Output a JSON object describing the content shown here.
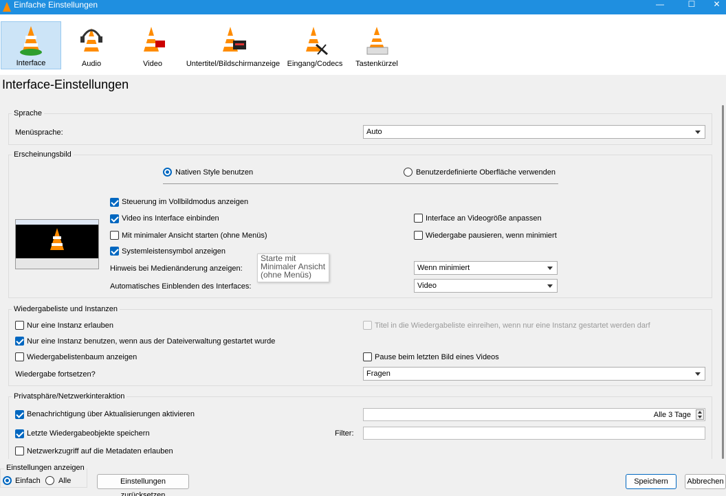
{
  "window": {
    "title": "Einfache Einstellungen",
    "minimize": "—",
    "maximize": "☐",
    "close": "✕"
  },
  "toolbar": {
    "items": [
      {
        "label": "Interface"
      },
      {
        "label": "Audio"
      },
      {
        "label": "Video"
      },
      {
        "label": "Untertitel/Bildschirmanzeige"
      },
      {
        "label": "Eingang/Codecs"
      },
      {
        "label": "Tastenkürzel"
      }
    ]
  },
  "page_title": "Interface-Einstellungen",
  "sprache": {
    "group_title": "Sprache",
    "menu_label": "Menüsprache:",
    "menu_value": "Auto"
  },
  "erscheinung": {
    "group_title": "Erscheinungsbild",
    "radio_native": "Nativen Style benutzen",
    "radio_custom": "Benutzerdefinierte Oberfläche verwenden",
    "chk_fullscreen": "Steuerung im Vollbildmodus anzeigen",
    "chk_embed": "Video ins Interface einbinden",
    "chk_minimal": "Mit minimaler Ansicht starten (ohne Menüs)",
    "chk_systray": "Systemleistensymbol anzeigen",
    "chk_resize": "Interface an Videogröße anpassen",
    "chk_pause_min": "Wiedergabe pausieren, wenn minimiert",
    "media_change_label": "Hinweis bei Medienänderung anzeigen:",
    "media_change_value": "Wenn minimiert",
    "auto_raise_label": "Automatisches Einblenden des Interfaces:",
    "auto_raise_value": "Video",
    "tooltip": [
      "Starte mit",
      "Minimaler Ansicht",
      "(ohne Menüs)"
    ]
  },
  "playlist": {
    "group_title": "Wiedergabeliste und Instanzen",
    "chk_one_instance": "Nur eine Instanz erlauben",
    "chk_enqueue": "Titel in die Wiedergabeliste einreihen, wenn nur eine Instanz gestartet werden darf",
    "chk_one_instance_fm": "Nur eine Instanz benutzen, wenn aus der Dateiverwaltung gestartet wurde",
    "chk_tree": "Wiedergabelistenbaum anzeigen",
    "chk_pause_last": "Pause beim letzten Bild eines Videos",
    "resume_label": "Wiedergabe fortsetzen?",
    "resume_value": "Fragen"
  },
  "privacy": {
    "group_title": "Privatsphäre/Netzwerkinteraktion",
    "chk_updates": "Benachrichtigung über Aktualisierungen aktivieren",
    "update_interval": "Alle 3 Tage",
    "chk_recent": "Letzte Wiedergabeobjekte speichern",
    "filter_label": "Filter:",
    "filter_value": "",
    "chk_metadata": "Netzwerkzugriff auf die Metadaten erlauben"
  },
  "footer": {
    "show_settings_title": "Einstellungen anzeigen",
    "radio_simple": "Einfach",
    "radio_all": "Alle",
    "reset_button": "Einstellungen zurücksetzen",
    "save_button": "Speichern",
    "cancel_button": "Abbrechen"
  },
  "colors": {
    "titlebar": "#1f8fe0",
    "accent": "#0067c0",
    "cone": "#ff8c00"
  }
}
